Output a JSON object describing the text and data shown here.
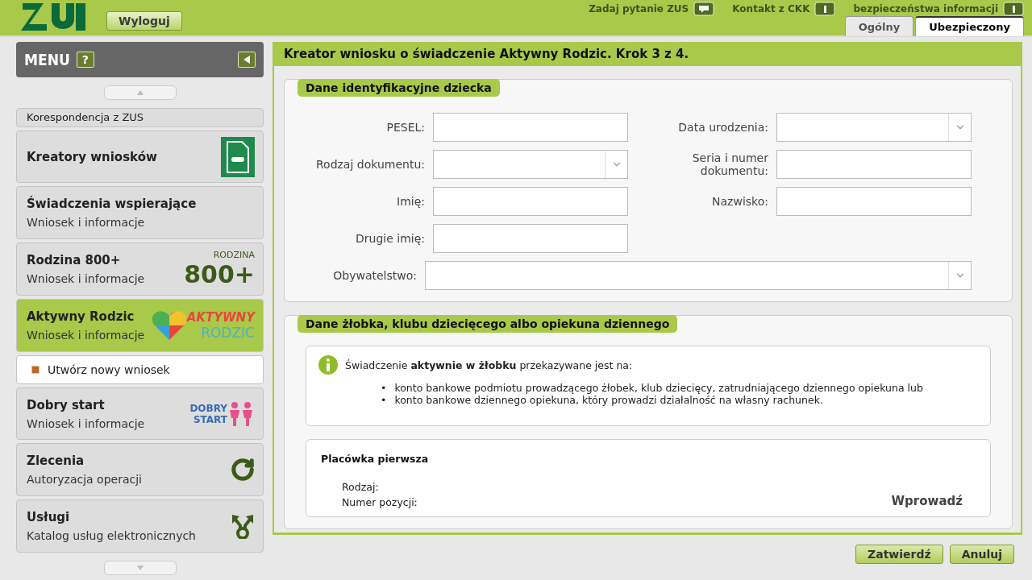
{
  "header": {
    "logout_button": "Wyloguj",
    "links": [
      {
        "label": "Zadaj pytanie ZUS"
      },
      {
        "label": "Kontakt z CKK"
      },
      {
        "label": "bezpieczeństwa informacji"
      }
    ],
    "tabs": [
      {
        "label": "Ogólny",
        "selected": false
      },
      {
        "label": "Ubezpieczony",
        "selected": true
      }
    ]
  },
  "sidebar": {
    "title": "MENU",
    "help": "?",
    "items": [
      {
        "kind": "partial",
        "title": "Korespondencja z ZUS",
        "selected": false
      },
      {
        "kind": "item",
        "title": "Kreatory wniosków",
        "selected": false
      },
      {
        "kind": "item",
        "title": "Świadczenia wspierające",
        "subtitle": "Wniosek i informacje",
        "selected": false
      },
      {
        "kind": "item",
        "title": "Rodzina 800+",
        "subtitle": "Wniosek i informacje",
        "logo": {
          "top": "RODZINA",
          "main": "800+"
        },
        "selected": false
      },
      {
        "kind": "item",
        "title": "Aktywny Rodzic",
        "subtitle": "Wniosek i informacje",
        "logo": {
          "top": "AKTYWNY",
          "main": "RODZIC"
        },
        "selected": true
      },
      {
        "kind": "sub",
        "title": "Utwórz nowy wniosek",
        "selected": false
      },
      {
        "kind": "item",
        "title": "Dobry start",
        "subtitle": "Wniosek i informacje",
        "logo": {
          "top": "DOBRY",
          "main": "START"
        },
        "selected": false
      },
      {
        "kind": "item",
        "title": "Zlecenia",
        "subtitle": "Autoryzacja operacji",
        "selected": false
      },
      {
        "kind": "item",
        "title": "Usługi",
        "subtitle": "Katalog usług elektronicznych",
        "selected": false
      }
    ]
  },
  "main": {
    "title": "Kreator wniosku o świadczenie Aktywny Rodzic. Krok 3 z 4.",
    "section_1": {
      "heading": "Dane identyfikacyjne dziecka",
      "fields": [
        {
          "label": "PESEL:",
          "kind": "text"
        },
        {
          "label": "Data urodzenia:",
          "kind": "select"
        },
        {
          "label": "Rodzaj dokumentu:",
          "kind": "select"
        },
        {
          "label": "Seria i numer dokumentu:",
          "kind": "text"
        },
        {
          "label": "Imię:",
          "kind": "text"
        },
        {
          "label": "Nazwisko:",
          "kind": "text"
        },
        {
          "label": "Drugie imię:",
          "kind": "text"
        }
      ],
      "citizenship": {
        "label": "Obywatelstwo:",
        "kind": "select"
      }
    },
    "section_2": {
      "heading": "Dane żłobka, klubu dziecięcego albo opiekuna dziennego",
      "info": {
        "text": "Świadczenie **aktywnie w żłobku** przekazywane jest na:",
        "bullets": [
          {
            "marker": "•",
            "text": "konto bankowe podmiotu prowadzącego żłobek, klub dziecięcy, zatrudniającego dziennego opiekuna lub"
          },
          {
            "marker": "•",
            "text": "konto bankowe dziennego opiekuna, który prowadzi działalność na własny rachunek."
          }
        ]
      },
      "facility": {
        "title": "Placówka pierwsza",
        "rows": [
          "Rodzaj:",
          "Numer pozycji:"
        ],
        "action": "Wprowadź"
      }
    }
  },
  "footer_buttons": [
    "Zatwierdź",
    "Anuluj"
  ]
}
